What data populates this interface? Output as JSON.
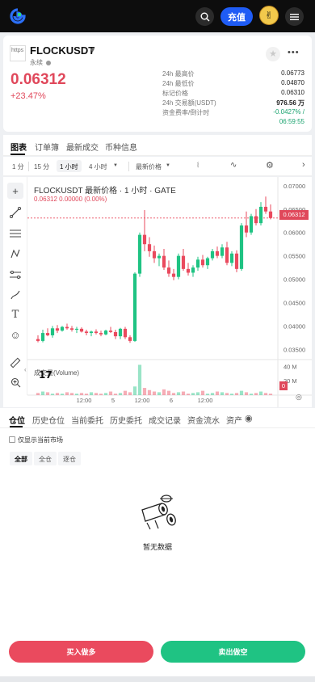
{
  "topbar": {
    "deposit_label": "充值"
  },
  "ticker": {
    "coin_img_alt": "https",
    "pair": "FLOCKUSDT",
    "contract_type": "永续",
    "last_price": "0.06312",
    "change_pct": "+23.47%",
    "stats": [
      {
        "label": "24h 最高价",
        "value": "0.06773"
      },
      {
        "label": "24h 最低价",
        "value": "0.04870"
      },
      {
        "label": "标记价格",
        "value": "0.06310"
      },
      {
        "label": "24h 交易额(USDT)",
        "value": "976.56 万"
      },
      {
        "label": "资金费率/倒计时",
        "value": "-0.0427% /",
        "value2": "06:59:55"
      }
    ]
  },
  "main_tabs": [
    "图表",
    "订单簿",
    "最新成交",
    "币种信息"
  ],
  "chart_toolbar": {
    "intervals": [
      "1 分",
      "15 分",
      "1 小时",
      "4 小时"
    ],
    "active_interval": "1 小时",
    "price_type": "最新价格"
  },
  "chart_header": {
    "title": "FLOCKUSDT 最新价格 · 1 小时 · GATE",
    "ohlc": "0.06312  0.00000 (0.00%)",
    "volume_label": "成交量(Volume)",
    "current_price_tag": "0.06312",
    "volume_zero_tag": "0"
  },
  "chart_data": {
    "type": "candlestick",
    "title": "FLOCKUSDT 最新价格 · 1 小时 · GATE",
    "y_ticks": [
      "0.07000",
      "0.06500",
      "0.06000",
      "0.05500",
      "0.05000",
      "0.04500",
      "0.04000",
      "0.03500"
    ],
    "ylim": [
      0.0335,
      0.0705
    ],
    "x_ticks": [
      "12:00",
      "5",
      "12:00",
      "6",
      "12:00"
    ],
    "volume_ticks": [
      "40 M",
      "20 M"
    ],
    "volume_ylim": [
      0,
      47
    ],
    "candles": [
      [
        0.0372,
        0.038,
        0.0365,
        0.0368
      ],
      [
        0.0368,
        0.0392,
        0.0365,
        0.0385
      ],
      [
        0.0385,
        0.0395,
        0.0378,
        0.038
      ],
      [
        0.038,
        0.04,
        0.0375,
        0.0395
      ],
      [
        0.0395,
        0.0402,
        0.0385,
        0.039
      ],
      [
        0.039,
        0.04,
        0.0388,
        0.0398
      ],
      [
        0.0398,
        0.0405,
        0.0392,
        0.0395
      ],
      [
        0.0395,
        0.04,
        0.0388,
        0.0392
      ],
      [
        0.0392,
        0.0398,
        0.0385,
        0.0394
      ],
      [
        0.0394,
        0.0397,
        0.0386,
        0.0388
      ],
      [
        0.0388,
        0.0392,
        0.038,
        0.0385
      ],
      [
        0.0385,
        0.039,
        0.0378,
        0.0388
      ],
      [
        0.0388,
        0.0393,
        0.0382,
        0.0385
      ],
      [
        0.0385,
        0.039,
        0.0378,
        0.0382
      ],
      [
        0.0382,
        0.0392,
        0.038,
        0.039
      ],
      [
        0.039,
        0.0398,
        0.0385,
        0.0387
      ],
      [
        0.0387,
        0.0392,
        0.0372,
        0.0378
      ],
      [
        0.0378,
        0.0396,
        0.0372,
        0.0394
      ],
      [
        0.0394,
        0.0398,
        0.0372,
        0.0376
      ],
      [
        0.0376,
        0.038,
        0.0364,
        0.0368
      ],
      [
        0.0368,
        0.0515,
        0.0366,
        0.0512
      ],
      [
        0.0512,
        0.06,
        0.0505,
        0.0595
      ],
      [
        0.0595,
        0.0648,
        0.056,
        0.0575
      ],
      [
        0.0575,
        0.059,
        0.0548,
        0.056
      ],
      [
        0.056,
        0.0572,
        0.0535,
        0.0545
      ],
      [
        0.0545,
        0.0555,
        0.0528,
        0.055
      ],
      [
        0.055,
        0.0565,
        0.052,
        0.0525
      ],
      [
        0.0525,
        0.054,
        0.0505,
        0.0512
      ],
      [
        0.0512,
        0.0522,
        0.0498,
        0.0505
      ],
      [
        0.0505,
        0.0555,
        0.05,
        0.055
      ],
      [
        0.055,
        0.0565,
        0.0518,
        0.0522
      ],
      [
        0.0522,
        0.0535,
        0.0508,
        0.0514
      ],
      [
        0.0514,
        0.053,
        0.0505,
        0.0525
      ],
      [
        0.0525,
        0.0548,
        0.0518,
        0.0542
      ],
      [
        0.0542,
        0.0552,
        0.0525,
        0.053
      ],
      [
        0.053,
        0.0548,
        0.0522,
        0.0545
      ],
      [
        0.0545,
        0.0565,
        0.054,
        0.056
      ],
      [
        0.056,
        0.057,
        0.0545,
        0.055
      ],
      [
        0.055,
        0.0575,
        0.0545,
        0.0568
      ],
      [
        0.0568,
        0.058,
        0.053,
        0.0535
      ],
      [
        0.0535,
        0.056,
        0.0528,
        0.0555
      ],
      [
        0.0555,
        0.0562,
        0.0515,
        0.0522
      ],
      [
        0.0522,
        0.062,
        0.0518,
        0.0615
      ],
      [
        0.0615,
        0.0645,
        0.059,
        0.06
      ],
      [
        0.06,
        0.064,
        0.0595,
        0.0635
      ],
      [
        0.0635,
        0.065,
        0.0615,
        0.062
      ],
      [
        0.062,
        0.0665,
        0.0615,
        0.0655
      ],
      [
        0.0655,
        0.0677,
        0.064,
        0.0645
      ],
      [
        0.0645,
        0.066,
        0.0628,
        0.0631
      ]
    ],
    "volumes": [
      3,
      5,
      4,
      2,
      3,
      2,
      4,
      3,
      2,
      3,
      2,
      4,
      3,
      2,
      3,
      5,
      2,
      3,
      6,
      4,
      12,
      42,
      10,
      7,
      5,
      4,
      8,
      6,
      3,
      4,
      5,
      2,
      3,
      4,
      6,
      2,
      3,
      5,
      4,
      3,
      2,
      3,
      6,
      4,
      2,
      3,
      5,
      3,
      2
    ]
  },
  "bottom": {
    "tabs": [
      "仓位",
      "历史仓位",
      "当前委托",
      "历史委托",
      "成交记录",
      "资金流水",
      "资产"
    ],
    "only_current": "仅显示当前市场",
    "filters": [
      "全部",
      "全仓",
      "逐仓"
    ],
    "empty_text": "暂无数据",
    "buy_label": "买入做多",
    "sell_label": "卖出做空"
  },
  "colors": {
    "up": "#1fc383",
    "down": "#ea4a5e",
    "accent": "#1f5cf5"
  }
}
